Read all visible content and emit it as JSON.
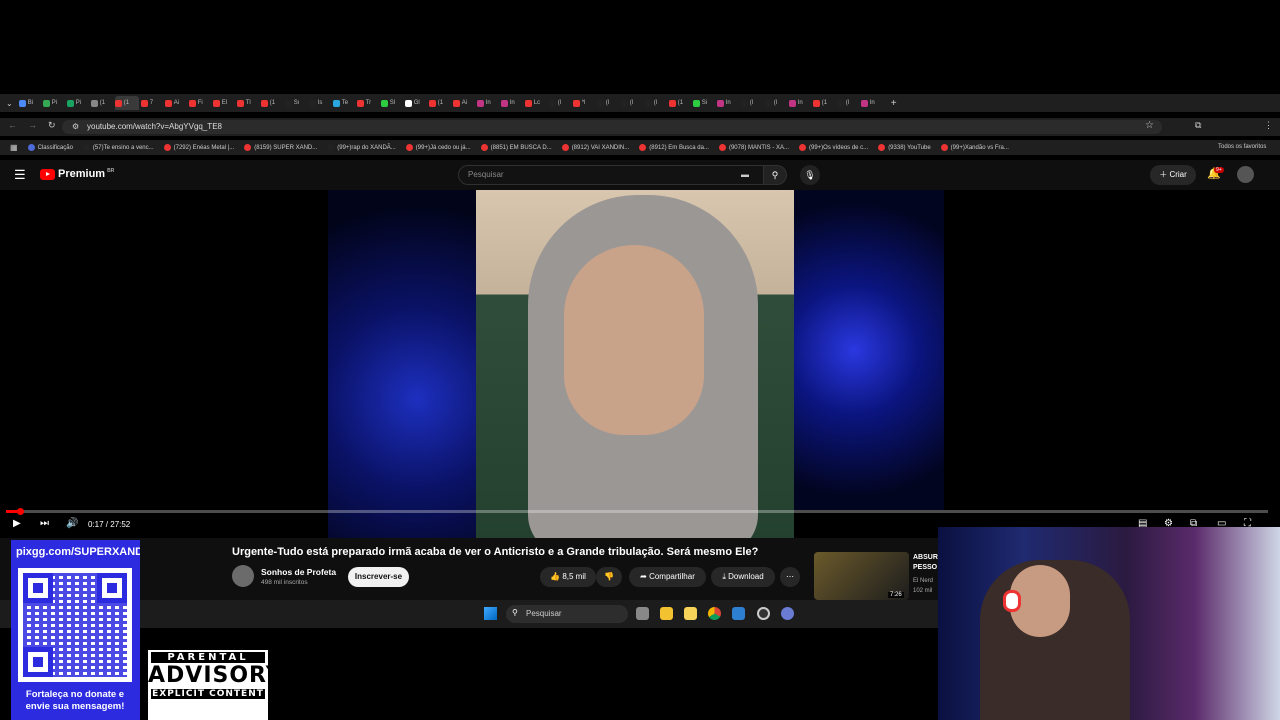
{
  "browser": {
    "tabs": [
      "Bi",
      "Pi",
      "Pi",
      "(1",
      "(1",
      "7",
      "Ai",
      "Fi",
      "El",
      "Tl",
      "(1",
      "Sı",
      "Is",
      "Te",
      "Tr",
      "Sl",
      "Gl",
      "(1",
      "Ai",
      "In",
      "In",
      "Lc",
      "(l",
      "*l",
      "(l",
      "(l",
      "(l",
      "(1",
      "Si",
      "In",
      "(l",
      "(l",
      "In",
      "(1",
      "(l",
      "In"
    ],
    "url": "youtube.com/watch?v=AbgYVgq_TE8",
    "bookmarks": [
      "Classificação",
      "(57)Te ensino a venc...",
      "(7292) Enéas Metal |...",
      "(8159) SUPER XAND...",
      "(99+)rap do XANDÃ...",
      "(99+)Já cedo ou já...",
      "(8851) EM BUSCA D...",
      "(8912) VAI XANDIN...",
      "(8912) Em Busca da...",
      "(9078) MANTIS - XA...",
      "(99+)Os vídeos de c...",
      "(9338) YouTube",
      "(99+)Xandão vs Fra..."
    ],
    "all_bookmarks": "Todos os favoritos"
  },
  "youtube": {
    "logo": "Premium",
    "logo_badge": "BR",
    "search_placeholder": "Pesquisar",
    "create_label": "Criar",
    "notif_count": "9+"
  },
  "player": {
    "time": "0:17 / 27:52",
    "progress": 0.01
  },
  "video": {
    "title": "Urgente-Tudo está preparado irmã acaba de ver o Anticristo e a Grande tribulação. Será mesmo Ele?",
    "channel": "Sonhos de Profeta",
    "subscribers": "498 mil inscritos",
    "subscribe_label": "Inscrever-se",
    "likes": "8,5 mil",
    "share_label": "Compartilhar",
    "download_label": "Download"
  },
  "recommended": {
    "title_line1": "ABSUR",
    "title_line2": "PESSO",
    "channel": "El Nerd",
    "views": "102 mil",
    "duration": "7:26"
  },
  "taskbar": {
    "search_placeholder": "Pesquisar"
  },
  "overlay": {
    "donate_url": "pixgg.com/SUPERXANDA",
    "donate_caption": "Fortaleça no donate e envie sua mensagem!",
    "advisory_top": "PARENTAL",
    "advisory_mid": "ADVISORY",
    "advisory_bottom": "EXPLICIT CONTENT"
  }
}
